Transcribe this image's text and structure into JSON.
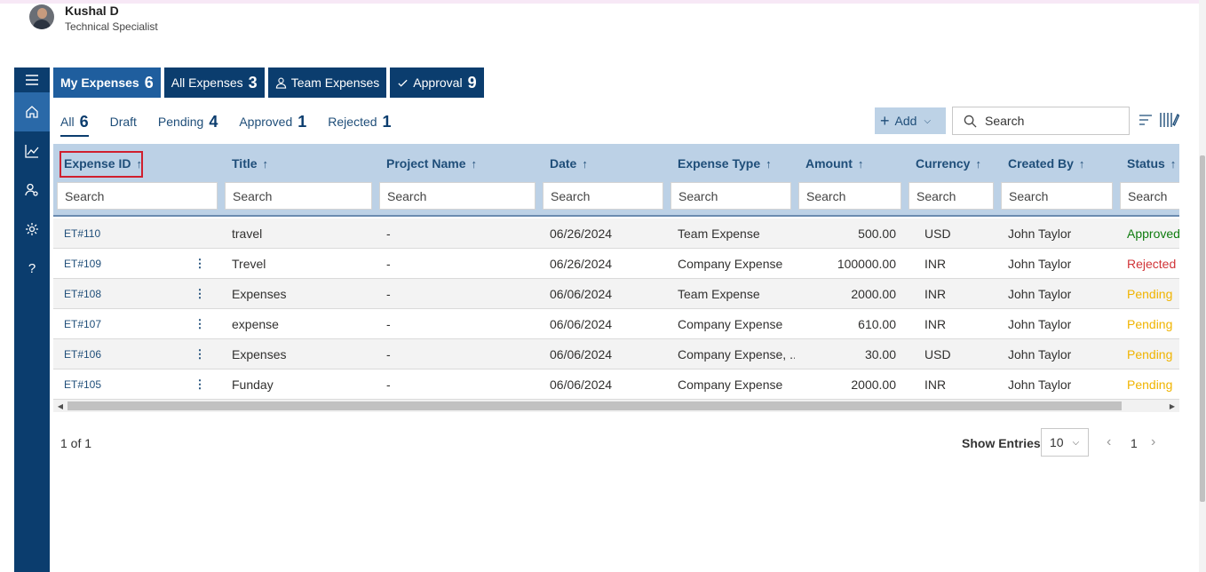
{
  "user": {
    "name": "Kushal D",
    "role": "Technical Specialist"
  },
  "sidebar": {
    "items": [
      {
        "icon": "menu-icon"
      },
      {
        "icon": "home-icon"
      },
      {
        "icon": "chart-icon"
      },
      {
        "icon": "user-settings-icon"
      },
      {
        "icon": "gear-icon"
      },
      {
        "icon": "help-icon",
        "label": "?"
      }
    ]
  },
  "maintabs": [
    {
      "label": "My Expenses",
      "count": "6"
    },
    {
      "label": "All Expenses",
      "count": "3"
    },
    {
      "label": "Team Expenses"
    },
    {
      "label": "Approval",
      "count": "9"
    }
  ],
  "subtabs": [
    {
      "label": "All",
      "count": "6"
    },
    {
      "label": "Draft"
    },
    {
      "label": "Pending",
      "count": "4"
    },
    {
      "label": "Approved",
      "count": "1"
    },
    {
      "label": "Rejected",
      "count": "1"
    }
  ],
  "toolbar": {
    "add_label": "Add",
    "search_placeholder": "Search"
  },
  "table": {
    "columns": [
      {
        "label": "Expense ID",
        "sort": "↑"
      },
      {
        "label": "Title",
        "sort": "↑"
      },
      {
        "label": "Project Name",
        "sort": "↑"
      },
      {
        "label": "Date",
        "sort": "↑"
      },
      {
        "label": "Expense Type",
        "sort": "↑"
      },
      {
        "label": "Amount",
        "sort": "↑"
      },
      {
        "label": "Currency",
        "sort": "↑"
      },
      {
        "label": "Created By",
        "sort": "↑"
      },
      {
        "label": "Status",
        "sort": "↑"
      }
    ],
    "filter_placeholder": "Search",
    "rows": [
      {
        "id": "ET#110",
        "title": "travel",
        "project": "-",
        "date": "06/26/2024",
        "type": "Team Expense",
        "amount": "500.00",
        "currency": "USD",
        "created_by": "John Taylor",
        "status": "Approved"
      },
      {
        "id": "ET#109",
        "title": "Trevel",
        "project": "-",
        "date": "06/26/2024",
        "type": "Company Expense",
        "amount": "100000.00",
        "currency": "INR",
        "created_by": "John Taylor",
        "status": "Rejected"
      },
      {
        "id": "ET#108",
        "title": "Expenses",
        "project": "-",
        "date": "06/06/2024",
        "type": "Team Expense",
        "amount": "2000.00",
        "currency": "INR",
        "created_by": "John Taylor",
        "status": "Pending"
      },
      {
        "id": "ET#107",
        "title": "expense",
        "project": "-",
        "date": "06/06/2024",
        "type": "Company Expense",
        "amount": "610.00",
        "currency": "INR",
        "created_by": "John Taylor",
        "status": "Pending"
      },
      {
        "id": "ET#106",
        "title": "Expenses",
        "project": "-",
        "date": "06/06/2024",
        "type": "Company Expense, ...",
        "amount": "30.00",
        "currency": "USD",
        "created_by": "John Taylor",
        "status": "Pending"
      },
      {
        "id": "ET#105",
        "title": "Funday",
        "project": "-",
        "date": "06/06/2024",
        "type": "Company Expense",
        "amount": "2000.00",
        "currency": "INR",
        "created_by": "John Taylor",
        "status": "Pending"
      }
    ]
  },
  "footer": {
    "page_info": "1 of 1",
    "show_entries_label": "Show Entries",
    "entries_value": "10",
    "current_page": "1"
  },
  "colors": {
    "primary": "#0b3d6e",
    "accent": "#1f5e9e",
    "header_bg": "#bcd1e6",
    "approved": "#107c10",
    "rejected": "#d13438",
    "pending": "#f0b400",
    "highlight_box": "#d01f2e"
  }
}
